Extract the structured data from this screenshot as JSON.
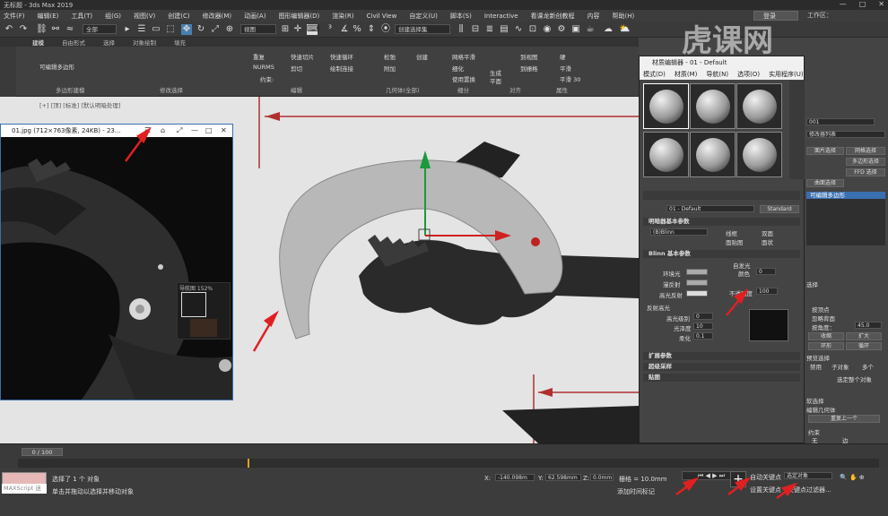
{
  "app": {
    "title": "无标题 - 3ds Max 2019",
    "workspace": "工作区：",
    "signin": "登录"
  },
  "menu": [
    "文件(F)",
    "编辑(E)",
    "工具(T)",
    "组(G)",
    "视图(V)",
    "创建(C)",
    "修改器(M)",
    "动画(A)",
    "图形编辑器(D)",
    "渲染(R)",
    "Civil View",
    "自定义(U)",
    "脚本(S)",
    "Interactive",
    "看课龙新创教程",
    "内容",
    "帮助(H)"
  ],
  "toolbar": {
    "filter": "全部",
    "refcoord": "视图",
    "selset": "创建选择集"
  },
  "ribbon": {
    "tabs": [
      "建模",
      "自由形式",
      "选择",
      "对象绘制",
      "填充"
    ],
    "group_labels": [
      "多边形建模",
      "修改选择",
      "编辑",
      "几何体(全部)",
      "细分",
      "对齐",
      "属性"
    ],
    "poly_label": "可编辑多边形",
    "edit_items": [
      "重复",
      "快速切片",
      "快速循环",
      "NURMS",
      "剪切",
      "绘制连接",
      "约束:"
    ],
    "geo_items": [
      "松弛",
      "创建",
      "附加"
    ],
    "sub_items": [
      "网格平滑",
      "细化",
      "使用置换"
    ],
    "align_items": [
      "生成",
      "平面"
    ],
    "prop_items": [
      "到视图",
      "到栅格",
      "硬",
      "平滑",
      "平滑 30"
    ]
  },
  "viewport": {
    "label": "[+] [顶] [标准] [默认明暗处理]"
  },
  "image_window": {
    "title": "01.jpg (712×763像素, 24KB) - 23...",
    "nav_label": "导航图 152%"
  },
  "material_editor": {
    "title": "材质编辑器 - 01 - Default",
    "menu": [
      "模式(D)",
      "材质(M)",
      "导航(N)",
      "选项(O)",
      "实用程序(U)"
    ],
    "material_name": "01 - Default",
    "material_type": "Standard",
    "shader_section": "明暗器基本参数",
    "shader": "(B)Blinn",
    "shader_opts": [
      "线框",
      "双面",
      "面贴图",
      "面状"
    ],
    "blinn_section": "Blinn 基本参数",
    "self_illum": "自发光",
    "color_label": "颜色",
    "color_value": "0",
    "ambient": "环境光",
    "diffuse": "漫反射",
    "specular": "高光反射",
    "opacity_label": "不透明度",
    "opacity_value": "100",
    "spec_section": "反射高光",
    "spec_level": "高光级别",
    "spec_level_value": "0",
    "glossiness": "光泽度",
    "glossiness_value": "10",
    "soften": "柔化",
    "soften_value": "0.1",
    "rollouts": [
      "扩展参数",
      "超级采样",
      "贴图"
    ]
  },
  "command_panel": {
    "obj_name": "001",
    "modifier_list": "修改器列表",
    "btns": [
      "面片选择",
      "网格选择",
      "多边形选择",
      "FFD 选择",
      "曲面选择"
    ],
    "stack_item": "可编辑多边形",
    "select_label": "选择",
    "by_vertex": "按顶点",
    "ignore_back": "忽略背面",
    "angle_label": "按角度：",
    "angle_value": "45.0",
    "shrink": "收缩",
    "grow": "扩大",
    "ring": "环形",
    "loop": "循环",
    "preview": "预览选择",
    "disable": "禁用",
    "subobj": "子对象",
    "multi": "多个",
    "select_all": "选定整个对象",
    "soft_sel": "软选择",
    "edit_geo": "编辑几何体",
    "repeat_last": "重复上一个",
    "constraint": "约束",
    "none": "无",
    "edge": "边"
  },
  "timeline": {
    "frame": "0 / 100"
  },
  "status": {
    "maxscript": "MAXScript 迷",
    "line1": "选择了 1 个 对象",
    "line2": "单击并拖动以选择并移动对象",
    "x_value": "-140.098m",
    "y_value": "62.598mm",
    "z_value": "0.0mm",
    "grid": "栅格 = 10.0mm",
    "add_time_tag": "添加时间标记",
    "auto_key": "自动关键点",
    "selected": "选定对象",
    "set_key": "设置关键点",
    "key_filters": "关键点过滤器..."
  },
  "watermark": "虎课网"
}
